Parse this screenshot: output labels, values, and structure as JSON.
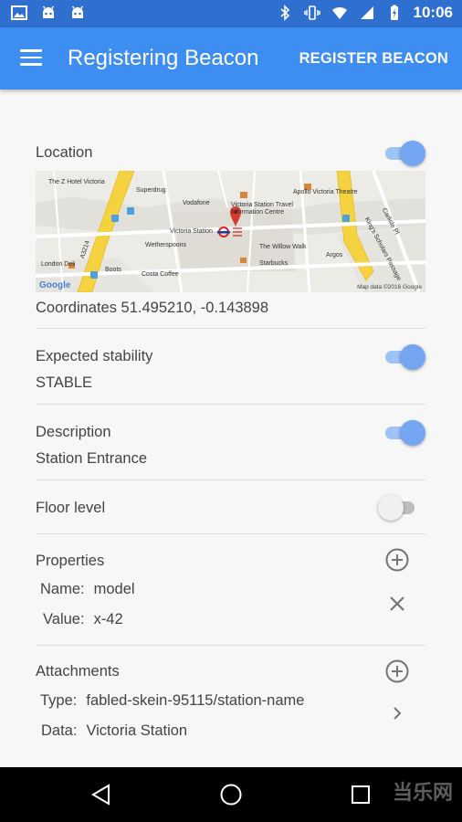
{
  "status_bar": {
    "time": "10:06"
  },
  "app_bar": {
    "title": "Registering Beacon",
    "action_label": "REGISTER BEACON"
  },
  "location": {
    "label": "Location",
    "switch_on": true,
    "coordinates_text": "Coordinates 51.495210, -0.143898",
    "map": {
      "labels": {
        "z_hotel": "The Z Hotel Victoria",
        "superdrug": "Superdrug",
        "vodafone": "Vodafone",
        "travel_centre": "Victoria Station Travel",
        "info_centre": "Information Centre",
        "apollo": "Apollo Victoria Theatre",
        "victoria_station": "Victoria Station",
        "wetherspoons": "Wetherspoons",
        "willow_walk": "The Willow Walk",
        "starbucks": "Starbucks",
        "argos": "Argos",
        "london_deli": "London Deli",
        "boots": "Boots",
        "costa": "Costa Coffee",
        "carlisle": "Carlisle Pl",
        "kings_scholars": "King's Scholars Passage",
        "a3214": "A3214",
        "google": "Google",
        "map_data": "Map data ©2016 Google"
      }
    }
  },
  "stability": {
    "label": "Expected stability",
    "value": "STABLE",
    "switch_on": true
  },
  "description": {
    "label": "Description",
    "value": "Station Entrance",
    "switch_on": true
  },
  "floor": {
    "label": "Floor level",
    "switch_on": false
  },
  "properties": {
    "label": "Properties",
    "name_key": "Name:",
    "name_value": "model",
    "value_key": "Value:",
    "value_value": "x-42"
  },
  "attachments": {
    "label": "Attachments",
    "type_key": "Type:",
    "type_value": "fabled-skein-95115/station-name",
    "data_key": "Data:",
    "data_value": "Victoria Station"
  },
  "watermark": "当乐网",
  "colors": {
    "primary": "#3d8ef0",
    "status_bar": "#2f6fcf",
    "switch_thumb_on": "#74a6f2"
  }
}
